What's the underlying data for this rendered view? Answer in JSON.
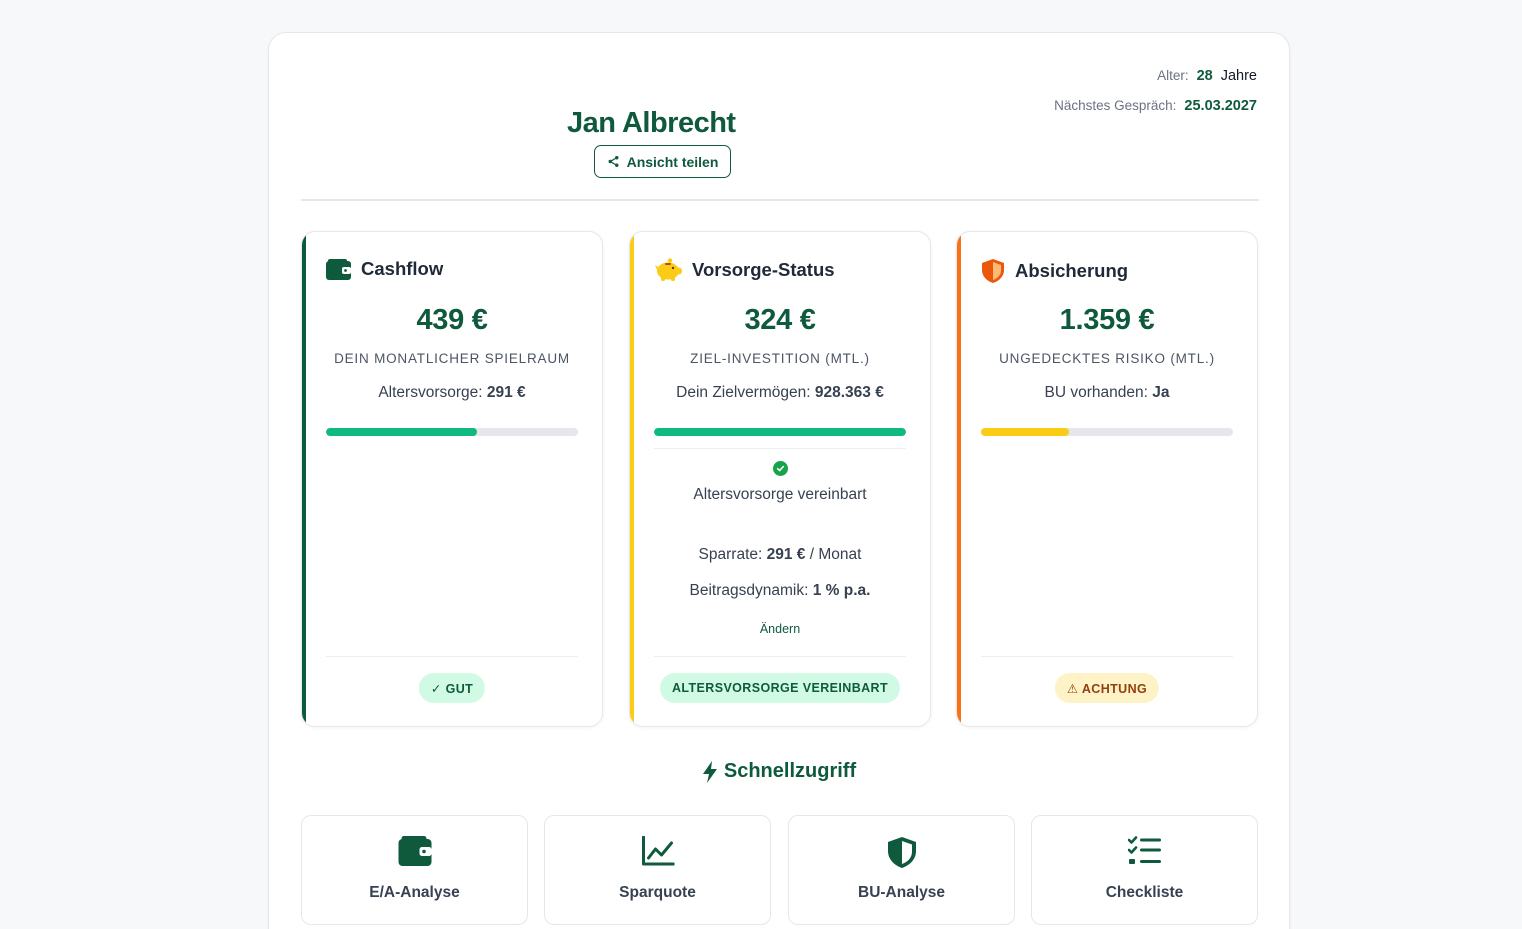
{
  "header": {
    "client_name": "Jan Albrecht",
    "age_label": "Alter:",
    "age_value": "28",
    "age_unit": "Jahre",
    "next_meeting_label": "Nächstes Gespräch:",
    "next_meeting_value": "25.03.2027",
    "share_button": "Ansicht teilen"
  },
  "cards": {
    "cashflow": {
      "title": "Cashflow",
      "icon": "wallet-icon",
      "amount": "439 €",
      "caption": "DEIN MONATLICHER SPIELRAUM",
      "sub_label": "Altersvorsorge:",
      "sub_value": "291 €",
      "progress": 0.6,
      "accent_color": "#0f5a3c",
      "bar_color": "#10b981",
      "badge": "✓ GUT"
    },
    "vorsorge": {
      "title": "Vorsorge-Status",
      "icon": "piggy-bank-icon",
      "amount": "324 €",
      "caption": "ZIEL-INVESTITION (MTL.)",
      "sub_label": "Dein Zielvermögen:",
      "sub_value": "928.363 €",
      "progress": 1.0,
      "accent_color": "#facc15",
      "bar_color": "#10b981",
      "agreed_text": "Altersvorsorge vereinbart",
      "savings_label": "Sparrate:",
      "savings_value": "291 €",
      "savings_unit": "/ Monat",
      "dynamics_label": "Beitragsdynamik:",
      "dynamics_value": "1 % p.a.",
      "change_link": "Ändern",
      "badge": "ALTERSVORSORGE VEREINBART"
    },
    "absicherung": {
      "title": "Absicherung",
      "icon": "shield-icon",
      "amount": "1.359 €",
      "caption": "UNGEDECKTES RISIKO (MTL.)",
      "sub_label": "BU vorhanden:",
      "sub_value": "Ja",
      "progress": 0.35,
      "accent_color": "#f97316",
      "bar_color": "#facc15",
      "badge": "⚠ ACHTUNG"
    }
  },
  "quick_access": {
    "title": "Schnellzugriff",
    "tiles": [
      {
        "label": "E/A-Analyse",
        "icon": "wallet-icon"
      },
      {
        "label": "Sparquote",
        "icon": "line-chart-icon"
      },
      {
        "label": "BU-Analyse",
        "icon": "shield-icon"
      },
      {
        "label": "Checkliste",
        "icon": "checklist-icon"
      }
    ]
  }
}
